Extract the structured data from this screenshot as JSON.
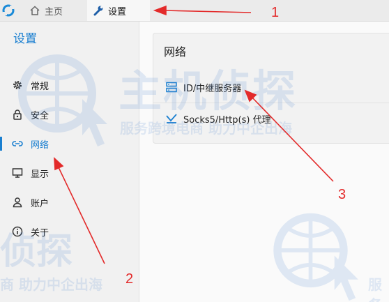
{
  "tabs": [
    {
      "label": "主页",
      "icon": "home-icon"
    },
    {
      "label": "设置",
      "icon": "wrench-icon"
    }
  ],
  "sidebar": {
    "title": "设置",
    "items": [
      {
        "label": "常规",
        "icon": "gear-icon"
      },
      {
        "label": "安全",
        "icon": "lock-icon"
      },
      {
        "label": "网络",
        "icon": "link-icon"
      },
      {
        "label": "显示",
        "icon": "monitor-icon"
      },
      {
        "label": "账户",
        "icon": "user-icon"
      },
      {
        "label": "关于",
        "icon": "info-icon"
      }
    ]
  },
  "main": {
    "card_title": "网络",
    "rows": [
      {
        "label": "ID/中继服务器",
        "icon": "server-icon"
      },
      {
        "label": "Socks5/Http(s) 代理",
        "icon": "proxy-icon"
      }
    ]
  },
  "annotations": [
    "1",
    "2",
    "3"
  ],
  "watermark": {
    "brand": "主机侦探",
    "slogan_1": "服务跨境电商 助力中企出海",
    "slogan_2": "商 助力中企出海",
    "slogan_3": "服务"
  },
  "colors": {
    "accent": "#1a7fd0",
    "annotation": "#e32a2a"
  }
}
